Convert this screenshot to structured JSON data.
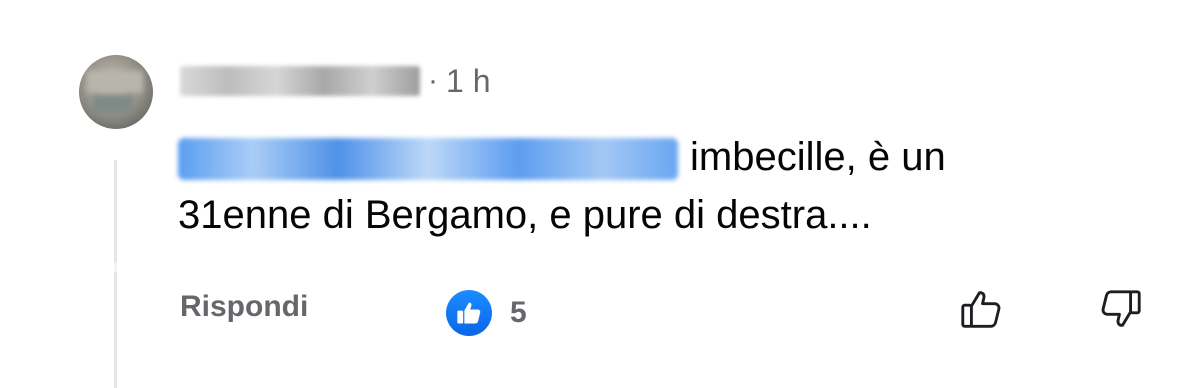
{
  "comment": {
    "timestamp": "1 h",
    "separator": "·",
    "text_line1": "imbecille, è un",
    "text_line2": "31enne di Bergamo, e pure di destra...."
  },
  "actions": {
    "reply_label": "Rispondi",
    "like_count": "5",
    "like_badge_icon": "thumbs-up-icon",
    "upvote_icon": "thumbs-up-outline-icon",
    "downvote_icon": "thumbs-down-outline-icon"
  },
  "colors": {
    "like_badge": "#1877f2",
    "secondary_text": "#65676b",
    "body_text": "#050505"
  }
}
